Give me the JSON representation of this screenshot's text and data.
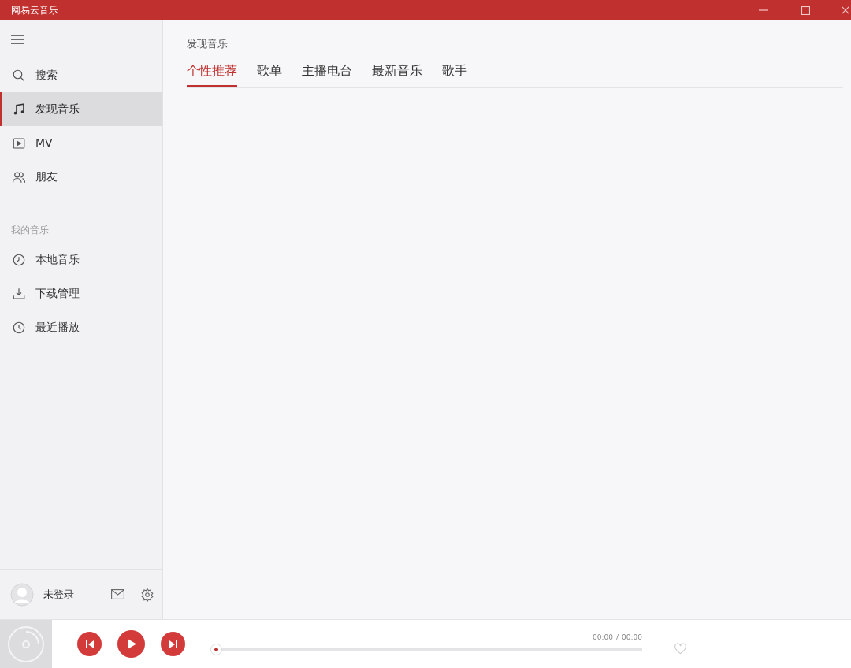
{
  "window": {
    "title": "网易云音乐"
  },
  "sidebar": {
    "items": [
      {
        "kind": "search",
        "label": "搜索",
        "selected": false
      },
      {
        "kind": "music",
        "label": "发现音乐",
        "selected": true
      },
      {
        "kind": "video",
        "label": "MV",
        "selected": false
      },
      {
        "kind": "friends",
        "label": "朋友",
        "selected": false
      }
    ],
    "section_title": "我的音乐",
    "my_music": [
      {
        "kind": "local",
        "label": "本地音乐",
        "selected": false
      },
      {
        "kind": "download",
        "label": "下载管理",
        "selected": false
      },
      {
        "kind": "recent",
        "label": "最近播放",
        "selected": false
      }
    ],
    "user": {
      "name": "未登录"
    }
  },
  "main": {
    "heading": "发现音乐",
    "tabs": [
      {
        "label": "个性推荐",
        "selected": true
      },
      {
        "label": "歌单",
        "selected": false
      },
      {
        "label": "主播电台",
        "selected": false
      },
      {
        "label": "最新音乐",
        "selected": false
      },
      {
        "label": "歌手",
        "selected": false
      }
    ]
  },
  "player": {
    "progress": {
      "level": 0
    },
    "time_elapsed": "00:00",
    "separator": "/",
    "time_total": "00:00"
  }
}
